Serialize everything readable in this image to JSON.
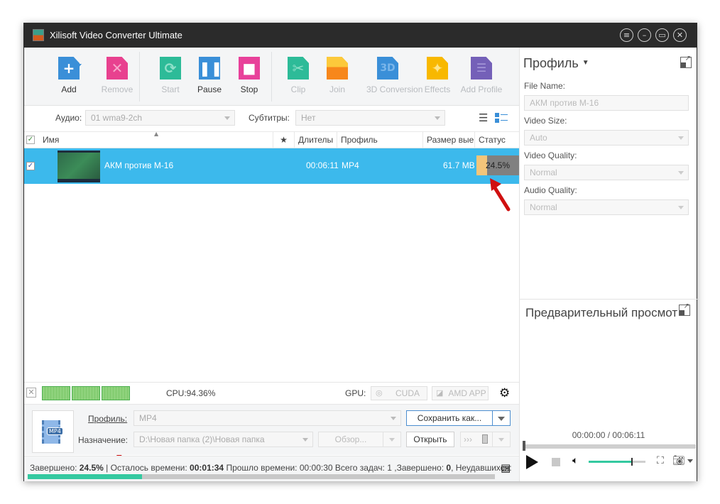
{
  "window": {
    "title": "Xilisoft Video Converter Ultimate",
    "controls": [
      "menu-icon",
      "minimize-icon",
      "maximize-icon",
      "close-icon"
    ]
  },
  "toolbar": {
    "buttons": [
      {
        "label": "Add",
        "icon": "add-file-icon",
        "enabled": true,
        "color": "#3a8fd8"
      },
      {
        "label": "Remove",
        "icon": "remove-file-icon",
        "enabled": false,
        "color": "#e8418f"
      },
      {
        "label": "Start",
        "icon": "start-icon",
        "enabled": false,
        "color": "#2dbb98"
      },
      {
        "label": "Pause",
        "icon": "pause-icon",
        "enabled": true,
        "color": "#3a8fd8"
      },
      {
        "label": "Stop",
        "icon": "stop-icon",
        "enabled": true,
        "color": "#e8419a"
      },
      {
        "label": "Clip",
        "icon": "scissors-icon",
        "enabled": false,
        "color": "#2dbb98"
      },
      {
        "label": "Join",
        "icon": "join-icon",
        "enabled": false,
        "color": "#f7a21b"
      },
      {
        "label": "3D Conversion",
        "icon": "3d-icon",
        "enabled": false,
        "color": "#3a8fd8"
      },
      {
        "label": "Effects",
        "icon": "magic-wand-icon",
        "enabled": false,
        "color": "#f8b800"
      },
      {
        "label": "Add Profile",
        "icon": "add-profile-icon",
        "enabled": false,
        "color": "#7460b8"
      }
    ],
    "icon_glyph_3d": "3D"
  },
  "filters": {
    "audio_label": "Аудио:",
    "audio_value": "01 wma9-2ch",
    "subtitles_label": "Субтитры:",
    "subtitles_value": "Нет"
  },
  "table": {
    "columns": [
      "Имя",
      "★",
      "Длителы",
      "Профиль",
      "Размер вые",
      "Статус"
    ],
    "rows": [
      {
        "checked": true,
        "name": "АКМ против М-16",
        "duration": "00:06:11",
        "profile": "MP4",
        "size": "61.7 MB",
        "progress_percent": 24.5,
        "status": "24.5%"
      }
    ]
  },
  "cpu": {
    "label": "CPU:94.36%",
    "gpu_label": "GPU:",
    "cuda": "CUDA",
    "amd": "AMD APP"
  },
  "output": {
    "profile_label": "Профиль:",
    "profile_value": "MP4",
    "destination_label": "Назначение:",
    "destination_value": "D:\\Новая папка (2)\\Новая папка",
    "save_as": "Сохранить как...",
    "browse": "Обзор...",
    "open": "Открыть",
    "badge": "MP4",
    "transfer_glyph": "›››"
  },
  "status": {
    "done_label": "Завершено:",
    "done_value": "24.5%",
    "remaining_label": "| Осталось времени:",
    "remaining_value": "00:01:34",
    "elapsed_label": "Прошло времени:",
    "elapsed_value": "00:00:30",
    "total_label": "Всего задач:",
    "total_value": "1",
    "completed_label": ",Завершено:",
    "completed_value": "0",
    "failed_label": ", Неудавшихся:",
    "progress_percent": 24.5
  },
  "profile_panel": {
    "title": "Профиль",
    "file_name_label": "File Name:",
    "file_name_value": "АКМ против М-16",
    "video_size_label": "Video Size:",
    "video_size_value": "Auto",
    "video_quality_label": "Video Quality:",
    "video_quality_value": "Normal",
    "audio_quality_label": "Audio Quality:",
    "audio_quality_value": "Normal"
  },
  "preview": {
    "title": "Предварительный просмотр",
    "time": "00:00:00 / 00:06:11",
    "seek_percent": 0,
    "volume_percent": 75
  }
}
